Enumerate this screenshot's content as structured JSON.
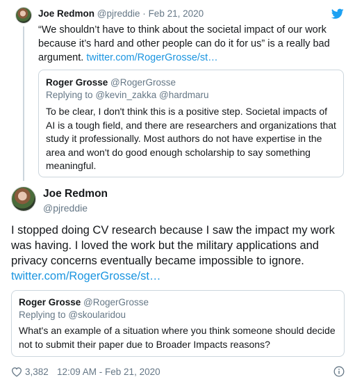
{
  "tweet1": {
    "name": "Joe Redmon",
    "handle": "@pjreddie",
    "sep": "·",
    "date": "Feb 21, 2020",
    "text": "“We shouldn’t have to think about the societal impact of our work because it’s hard and other people can do it for us” is a really bad argument.",
    "link": "twitter.com/RogerGrosse/st…",
    "quote": {
      "name": "Roger Grosse",
      "handle": "@RogerGrosse",
      "replying_prefix": "Replying to",
      "replying_to": "@kevin_zakka @hardmaru",
      "text": "To be clear, I don't think this is a positive step. Societal impacts of AI is a tough field, and there are researchers and organizations that study it professionally. Most authors do not have expertise in the area and won't do good enough scholarship to say something meaningful."
    }
  },
  "tweet2": {
    "name": "Joe Redmon",
    "handle": "@pjreddie",
    "text": "I stopped doing CV research because I saw the impact my work was having. I loved the work but the military applications and privacy concerns eventually became impossible to ignore.",
    "link": "twitter.com/RogerGrosse/st…",
    "quote": {
      "name": "Roger Grosse",
      "handle": "@RogerGrosse",
      "replying_prefix": "Replying to",
      "replying_to": "@skoularidou",
      "text": "What's an example of a situation where you think someone should decide not to submit their paper due to Broader Impacts reasons?"
    },
    "likes": "3,382",
    "timestamp": "12:09 AM - Feb 21, 2020"
  },
  "icons": {
    "bird": "twitter-bird-icon",
    "heart": "heart-icon",
    "info": "info-icon"
  },
  "colors": {
    "link": "#1b95e0",
    "muted": "#657786",
    "border": "#ccd6dd",
    "text": "#14171a"
  }
}
